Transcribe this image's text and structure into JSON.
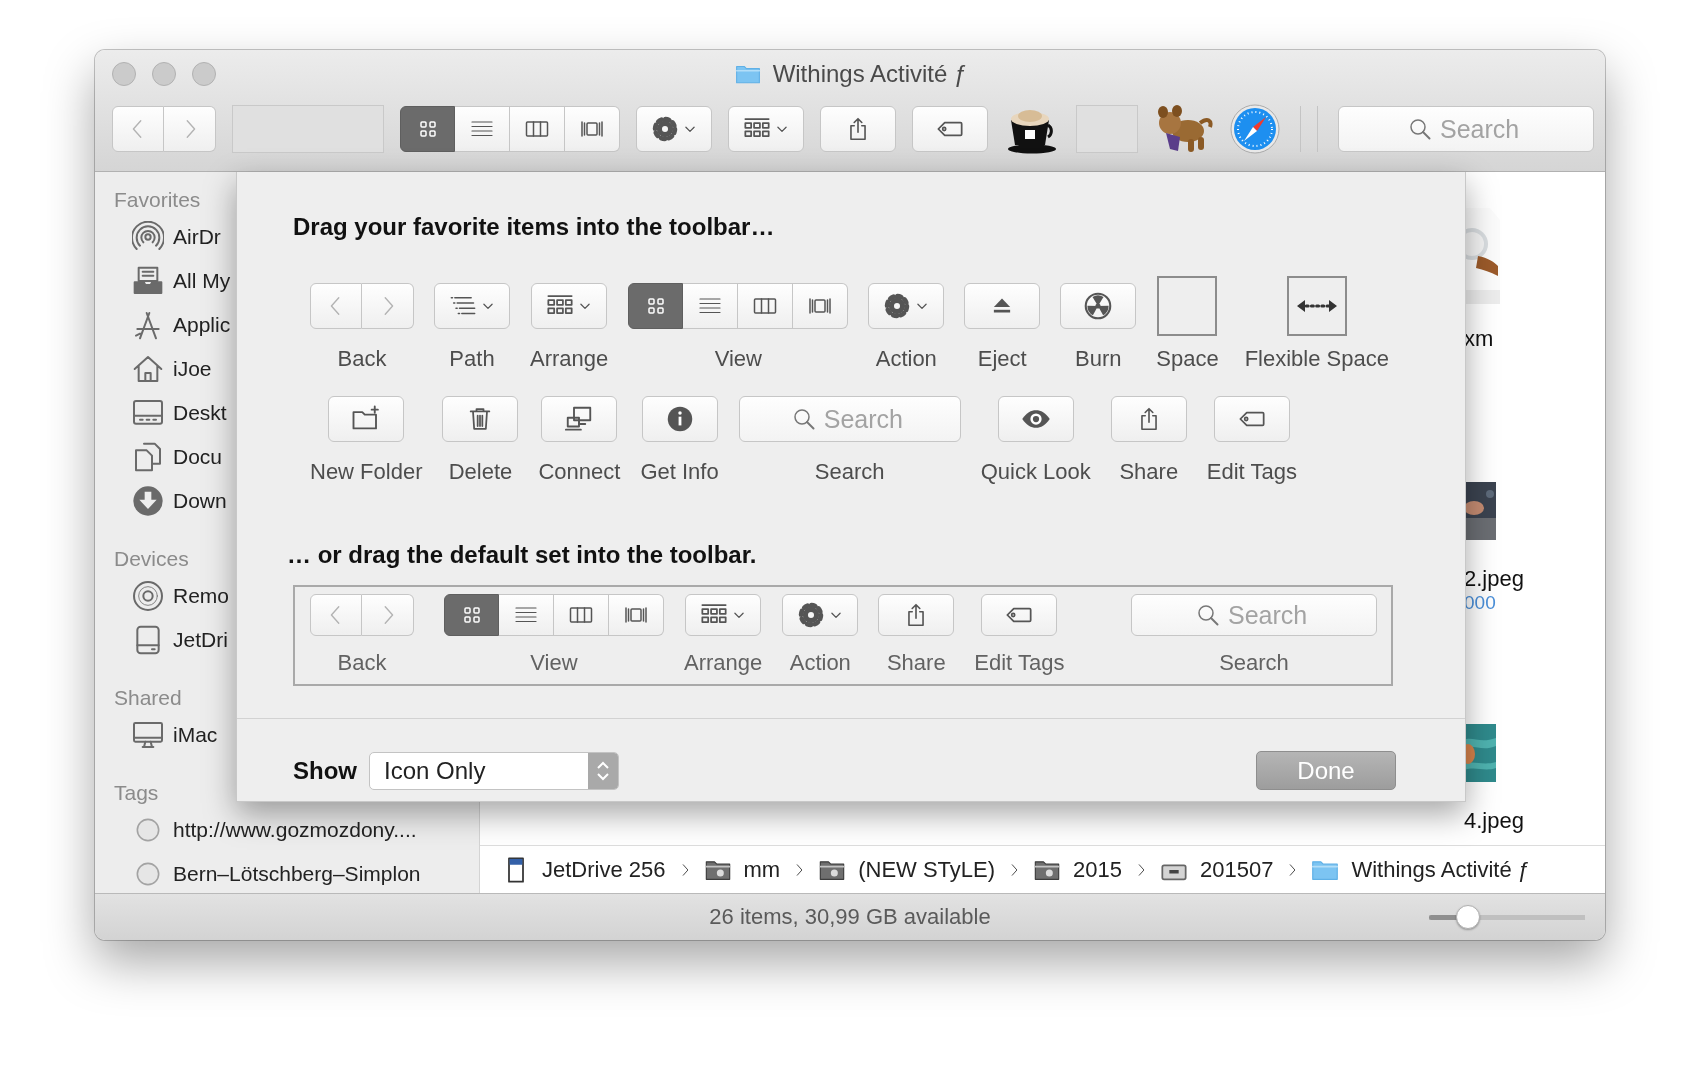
{
  "window": {
    "title": "Withings Activité ƒ"
  },
  "toolbar": {
    "items": [
      {
        "kind": "nav"
      },
      {
        "kind": "blank"
      },
      {
        "kind": "view",
        "segments": [
          {
            "selected": true
          },
          {
            "selected": false
          },
          {
            "selected": false
          },
          {
            "selected": false
          }
        ]
      },
      {
        "kind": "action"
      },
      {
        "kind": "arrange"
      },
      {
        "kind": "share"
      },
      {
        "kind": "tags"
      },
      {
        "kind": "coffee"
      },
      {
        "kind": "space_box"
      },
      {
        "kind": "creature"
      },
      {
        "kind": "compass"
      },
      {
        "kind": "separator"
      },
      {
        "kind": "search",
        "placeholder": "Search"
      }
    ]
  },
  "sidebar": {
    "sections": [
      {
        "title": "Favorites",
        "items": [
          {
            "kind": "airdrop",
            "label": "AirDr"
          },
          {
            "kind": "allfiles",
            "label": "All My"
          },
          {
            "kind": "apps",
            "label": "Applic"
          },
          {
            "kind": "home",
            "label": "iJoe"
          },
          {
            "kind": "desktop",
            "label": "Deskt"
          },
          {
            "kind": "documents",
            "label": "Docu"
          },
          {
            "kind": "downloads",
            "label": "Down"
          }
        ]
      },
      {
        "title": "Devices",
        "items": [
          {
            "kind": "disc",
            "label": "Remo"
          },
          {
            "kind": "drive",
            "label": "JetDri"
          }
        ]
      },
      {
        "title": "Shared",
        "items": [
          {
            "kind": "computer",
            "label": "iMac"
          }
        ]
      },
      {
        "title": "Tags",
        "items": [
          {
            "kind": "tag",
            "label": "http://www.gozmozdony...."
          },
          {
            "kind": "tag",
            "label": "Bern–Lötschberg–Simplon"
          }
        ]
      }
    ]
  },
  "files": [
    {
      "kind": "watch",
      "label": "xm"
    },
    {
      "kind": "dark",
      "label": "2.jpeg",
      "detail": "000"
    },
    {
      "kind": "water",
      "label": "4.jpeg"
    }
  ],
  "path_bar": {
    "items": [
      {
        "kind": "sdcard",
        "label": "JetDrive 256"
      },
      {
        "kind": "grayfolder",
        "label": "mm"
      },
      {
        "kind": "grayfolder",
        "label": "(NEW STyLE)"
      },
      {
        "kind": "grayfolder",
        "label": "2015"
      },
      {
        "kind": "diskbox",
        "label": "201507"
      },
      {
        "kind": "bluefolder",
        "label": "Withings Activité ƒ"
      }
    ]
  },
  "status_bar": {
    "text": "26 items, 30,99 GB available",
    "zoom_slider": {
      "level": 0.25
    }
  },
  "customize_sheet": {
    "heading": "Drag your favorite items into the toolbar…",
    "rows": [
      {
        "items": [
          {
            "kind": "nav",
            "label": "Back"
          },
          {
            "kind": "path",
            "label": "Path"
          },
          {
            "kind": "arrange",
            "label": "Arrange"
          },
          {
            "kind": "view",
            "label": "View",
            "segments": [
              {
                "selected": true
              },
              {
                "selected": false
              },
              {
                "selected": false
              },
              {
                "selected": false
              }
            ]
          },
          {
            "kind": "action",
            "label": "Action"
          },
          {
            "kind": "eject",
            "label": "Eject"
          },
          {
            "kind": "burn",
            "label": "Burn"
          },
          {
            "kind": "space",
            "label": "Space"
          },
          {
            "kind": "flexspace",
            "label": "Flexible Space"
          }
        ]
      },
      {
        "items": [
          {
            "kind": "newfolder",
            "label": "New Folder"
          },
          {
            "kind": "delete",
            "label": "Delete"
          },
          {
            "kind": "connect",
            "label": "Connect"
          },
          {
            "kind": "info",
            "label": "Get Info"
          },
          {
            "kind": "search",
            "placeholder": "Search",
            "label": "Search"
          },
          {
            "kind": "quicklook",
            "label": "Quick Look"
          },
          {
            "kind": "share",
            "label": "Share"
          },
          {
            "kind": "tags",
            "label": "Edit Tags"
          }
        ]
      }
    ],
    "default_heading": "… or drag the default set into the toolbar.",
    "default_set": [
      {
        "kind": "nav",
        "label": "Back"
      },
      {
        "kind": "view",
        "label": "View",
        "segments": [
          {
            "selected": true
          },
          {
            "selected": false
          },
          {
            "selected": false
          },
          {
            "selected": false
          }
        ]
      },
      {
        "kind": "arrange",
        "label": "Arrange"
      },
      {
        "kind": "action",
        "label": "Action"
      },
      {
        "kind": "share",
        "label": "Share"
      },
      {
        "kind": "tags",
        "label": "Edit Tags"
      },
      {
        "kind": "search",
        "placeholder": "Search",
        "label": "Search"
      }
    ],
    "show_label": "Show",
    "show_value": "Icon Only",
    "done_button": "Done"
  }
}
